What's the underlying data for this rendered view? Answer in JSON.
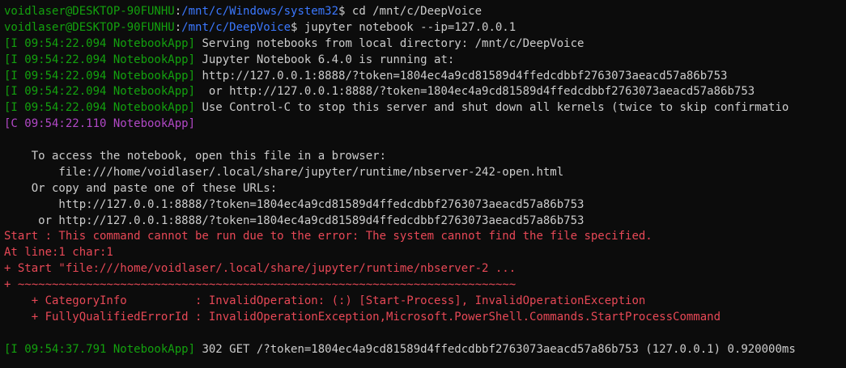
{
  "colors": {
    "background": "#0c0c0c",
    "foreground": "#cccccc",
    "user_host": "#13a10e",
    "path": "#3b78ff",
    "log_info": "#13a10e",
    "log_critical": "#b148c6",
    "error": "#e74856"
  },
  "lines": [
    {
      "segments": [
        {
          "text": "voidlaser@DESKTOP-90FUNHU",
          "color": "green"
        },
        {
          "text": ":",
          "color": "white"
        },
        {
          "text": "/mnt/c/Windows/system32",
          "color": "blue"
        },
        {
          "text": "$ cd /mnt/c/DeepVoice",
          "color": "white"
        }
      ]
    },
    {
      "segments": [
        {
          "text": "voidlaser@DESKTOP-90FUNHU",
          "color": "green"
        },
        {
          "text": ":",
          "color": "white"
        },
        {
          "text": "/mnt/c/DeepVoice",
          "color": "blue"
        },
        {
          "text": "$ jupyter notebook --ip=127.0.0.1",
          "color": "white"
        }
      ]
    },
    {
      "segments": [
        {
          "text": "[I 09:54:22.094 NotebookApp]",
          "color": "green"
        },
        {
          "text": " Serving notebooks from local directory: /mnt/c/DeepVoice",
          "color": "white"
        }
      ]
    },
    {
      "segments": [
        {
          "text": "[I 09:54:22.094 NotebookApp]",
          "color": "green"
        },
        {
          "text": " Jupyter Notebook 6.4.0 is running at:",
          "color": "white"
        }
      ]
    },
    {
      "segments": [
        {
          "text": "[I 09:54:22.094 NotebookApp]",
          "color": "green"
        },
        {
          "text": " http://127.0.0.1:8888/?token=1804ec4a9cd81589d4ffedcdbbf2763073aeacd57a86b753",
          "color": "white"
        }
      ]
    },
    {
      "segments": [
        {
          "text": "[I 09:54:22.094 NotebookApp]",
          "color": "green"
        },
        {
          "text": "  or http://127.0.0.1:8888/?token=1804ec4a9cd81589d4ffedcdbbf2763073aeacd57a86b753",
          "color": "white"
        }
      ]
    },
    {
      "segments": [
        {
          "text": "[I 09:54:22.094 NotebookApp]",
          "color": "green"
        },
        {
          "text": " Use Control-C to stop this server and shut down all kernels (twice to skip confirmatio",
          "color": "white"
        }
      ]
    },
    {
      "segments": [
        {
          "text": "[C 09:54:22.110 NotebookApp]",
          "color": "purple"
        }
      ]
    },
    {
      "segments": [
        {
          "text": "",
          "color": "white"
        }
      ]
    },
    {
      "segments": [
        {
          "text": "    To access the notebook, open this file in a browser:",
          "color": "white"
        }
      ]
    },
    {
      "segments": [
        {
          "text": "        file:///home/voidlaser/.local/share/jupyter/runtime/nbserver-242-open.html",
          "color": "white"
        }
      ]
    },
    {
      "segments": [
        {
          "text": "    Or copy and paste one of these URLs:",
          "color": "white"
        }
      ]
    },
    {
      "segments": [
        {
          "text": "        http://127.0.0.1:8888/?token=1804ec4a9cd81589d4ffedcdbbf2763073aeacd57a86b753",
          "color": "white"
        }
      ]
    },
    {
      "segments": [
        {
          "text": "     or http://127.0.0.1:8888/?token=1804ec4a9cd81589d4ffedcdbbf2763073aeacd57a86b753",
          "color": "white"
        }
      ]
    },
    {
      "segments": [
        {
          "text": "Start : This command cannot be run due to the error: The system cannot find the file specified.",
          "color": "red"
        }
      ]
    },
    {
      "segments": [
        {
          "text": "At line:1 char:1",
          "color": "red"
        }
      ]
    },
    {
      "segments": [
        {
          "text": "+ Start \"file:///home/voidlaser/.local/share/jupyter/runtime/nbserver-2 ...",
          "color": "red"
        }
      ]
    },
    {
      "segments": [
        {
          "text": "+ ~~~~~~~~~~~~~~~~~~~~~~~~~~~~~~~~~~~~~~~~~~~~~~~~~~~~~~~~~~~~~~~~~~~~~~~~~",
          "color": "red"
        }
      ]
    },
    {
      "segments": [
        {
          "text": "    + CategoryInfo          : InvalidOperation: (:) [Start-Process], InvalidOperationException",
          "color": "red"
        }
      ]
    },
    {
      "segments": [
        {
          "text": "    + FullyQualifiedErrorId : InvalidOperationException,Microsoft.PowerShell.Commands.StartProcessCommand",
          "color": "red"
        }
      ]
    },
    {
      "segments": [
        {
          "text": "",
          "color": "white"
        }
      ]
    },
    {
      "segments": [
        {
          "text": "[I 09:54:37.791 NotebookApp]",
          "color": "green"
        },
        {
          "text": " 302 GET /?token=1804ec4a9cd81589d4ffedcdbbf2763073aeacd57a86b753 (127.0.0.1) 0.920000ms",
          "color": "white"
        }
      ]
    }
  ]
}
